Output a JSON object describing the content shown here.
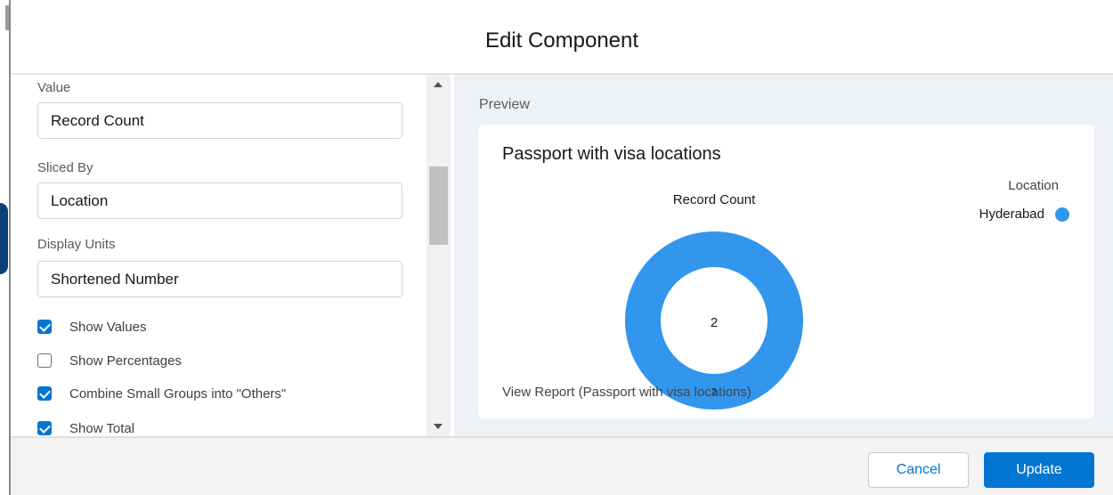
{
  "modal": {
    "title": "Edit Component"
  },
  "form": {
    "value_label": "Value",
    "value": "Record Count",
    "sliced_by_label": "Sliced By",
    "sliced_by": "Location",
    "display_units_label": "Display Units",
    "display_units": "Shortened Number",
    "checkboxes": [
      {
        "label": "Show Values",
        "checked": true
      },
      {
        "label": "Show Percentages",
        "checked": false
      },
      {
        "label": "Combine Small Groups into \"Others\"",
        "checked": true
      },
      {
        "label": "Show Total",
        "checked": true
      }
    ]
  },
  "preview": {
    "label": "Preview",
    "card_title": "Passport with visa locations",
    "chart_subtitle": "Record Count",
    "center_total": "2",
    "slice_label": "2",
    "legend_title": "Location",
    "view_report": "View Report (Passport with visa locations)"
  },
  "chart_data": {
    "type": "pie",
    "subtitle": "Record Count",
    "legend_title": "Location",
    "legend_placement": "top-right",
    "categories": [
      "Hyderabad"
    ],
    "values": [
      2
    ],
    "total": 2,
    "colors": [
      "#3296ed"
    ]
  },
  "footer": {
    "cancel_label": "Cancel",
    "update_label": "Update"
  },
  "colors": {
    "accent": "#0176d3",
    "slice": "#3296ed"
  }
}
